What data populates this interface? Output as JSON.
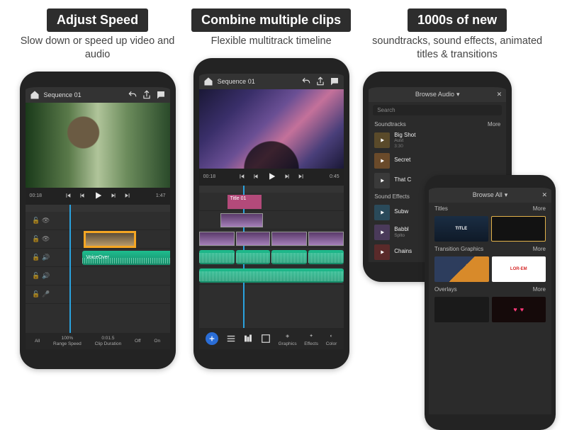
{
  "panel1": {
    "headline": "Adjust Speed",
    "subhead": "Slow down or speed up video and audio",
    "topbar": {
      "title": "Sequence 01"
    },
    "time_current": "00:18",
    "time_total": "1:47",
    "audio_clip_label": "VoiceOver",
    "bottombar": {
      "c1_val": "All",
      "c1_lbl": "",
      "c2_val": "100%",
      "c2_lbl": "Range Speed",
      "c3_val": "0:01.5",
      "c3_lbl": "Clip Duration",
      "c4_val": "Off",
      "c4_lbl": "",
      "c5_val": "On",
      "c5_lbl": ""
    }
  },
  "panel2": {
    "headline": "Combine multiple clips",
    "subhead": "Flexible multitrack timeline",
    "topbar": {
      "title": "Sequence 01"
    },
    "time_current": "00:18",
    "time_total": "0:45",
    "title_clip": "Title 01",
    "bottombar": {
      "graphics": "Graphics",
      "effects": "Effects",
      "color": "Color"
    }
  },
  "panel3": {
    "headline": "1000s of new",
    "subhead": "soundtracks, sound effects, animated titles & transitions",
    "browse_audio": "Browse Audio",
    "search_placeholder": "Search",
    "soundtracks_label": "Soundtracks",
    "more_label": "More",
    "sound_effects_label": "Sound Effects",
    "items": [
      {
        "title": "Big Shot",
        "sub": "Aust",
        "dur": "3:30"
      },
      {
        "title": "Secret",
        "sub": "",
        "dur": ""
      },
      {
        "title": "That C",
        "sub": "",
        "dur": ""
      },
      {
        "title": "Subw",
        "sub": "",
        "dur": ""
      },
      {
        "title": "Babbl",
        "sub": "Splto",
        "dur": ""
      },
      {
        "title": "Chains",
        "sub": "",
        "dur": ""
      }
    ],
    "inner": {
      "browse_all": "Browse All",
      "titles_label": "Titles",
      "transition_label": "Transition Graphics",
      "overlays_label": "Overlays",
      "tile_title_text": "TITLE",
      "tile_lorem": "LOR-EM"
    }
  },
  "icons": {
    "home": "home-icon",
    "undo": "undo-icon",
    "share": "share-icon",
    "comment": "comment-icon",
    "skip_start": "skip-start-icon",
    "step_back": "step-back-icon",
    "play": "play-icon",
    "step_fwd": "step-forward-icon",
    "skip_end": "skip-end-icon",
    "close": "close-icon",
    "chevron_down": "chevron-down-icon",
    "plus": "plus-icon"
  }
}
